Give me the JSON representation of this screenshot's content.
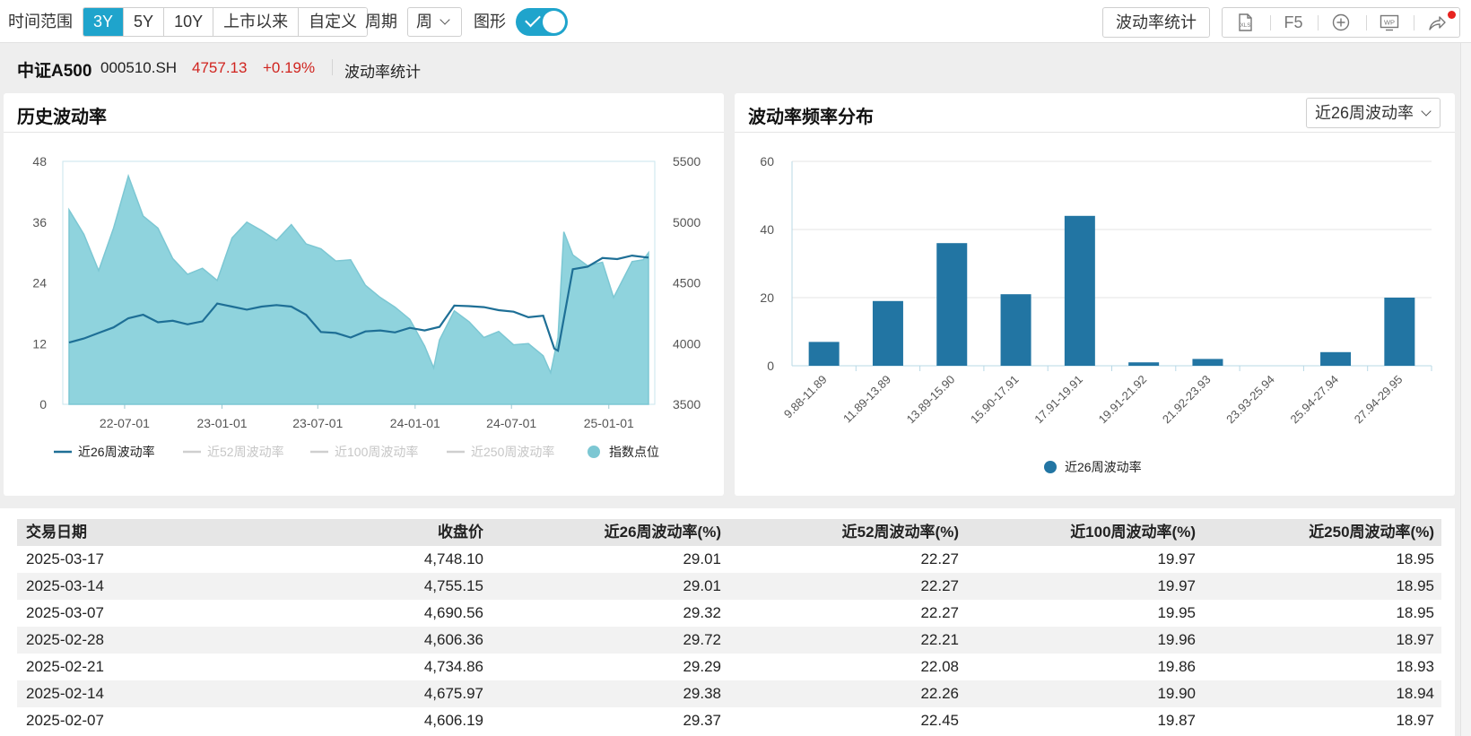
{
  "toolbar": {
    "range_label": "时间范围",
    "range_options": [
      "3Y",
      "5Y",
      "10Y",
      "上市以来",
      "自定义"
    ],
    "range_active": "3Y",
    "period_label": "周期",
    "period_value": "周",
    "chart_label": "图形",
    "stats_button": "波动率统计",
    "icons": [
      "xls-export-icon",
      "refresh-icon",
      "add-icon",
      "wp-export-icon",
      "share-icon"
    ],
    "refresh_label": "F5",
    "xls_label": "XLS",
    "wp_label": "WP"
  },
  "info": {
    "name": "中证A500",
    "code": "000510.SH",
    "price": "4757.13",
    "change": "+0.19%",
    "section": "波动率统计"
  },
  "colors": {
    "accent": "#1fa4cc",
    "up": "#d0241f",
    "line_series": "#1e6f96",
    "area_fill": "#8fd3dd",
    "bar_fill": "#2275a3"
  },
  "left_panel": {
    "title": "历史波动率"
  },
  "right_panel": {
    "title": "波动率频率分布",
    "select_value": "近26周波动率"
  },
  "chart_data": [
    {
      "type": "line",
      "title": "历史波动率",
      "x_ticks": [
        "22-07-01",
        "23-01-01",
        "23-07-01",
        "24-01-01",
        "24-07-01",
        "25-01-01"
      ],
      "x_range": [
        "2022-03-18",
        "2025-03-17"
      ],
      "ylim": [
        0,
        48
      ],
      "y_ticks": [
        "0",
        "12",
        "24",
        "36",
        "48"
      ],
      "y2lim": [
        3500,
        5500
      ],
      "y2_ticks": [
        "3500",
        "4000",
        "4500",
        "5000",
        "5500"
      ],
      "legend": [
        {
          "name": "近26周波动率",
          "active": true
        },
        {
          "name": "近52周波动率",
          "active": false
        },
        {
          "name": "近100周波动率",
          "active": false
        },
        {
          "name": "近250周波动率",
          "active": false
        },
        {
          "name": "指数点位",
          "active": true
        }
      ],
      "series": [
        {
          "name": "近26周波动率",
          "axis": "left",
          "x": [
            "2022-03-18",
            "2022-04-15",
            "2022-05-13",
            "2022-06-10",
            "2022-07-08",
            "2022-08-05",
            "2022-09-02",
            "2022-09-30",
            "2022-10-28",
            "2022-11-25",
            "2022-12-23",
            "2023-01-20",
            "2023-02-17",
            "2023-03-17",
            "2023-04-14",
            "2023-05-12",
            "2023-06-09",
            "2023-07-07",
            "2023-08-04",
            "2023-09-01",
            "2023-09-29",
            "2023-10-27",
            "2023-11-24",
            "2023-12-22",
            "2024-01-19",
            "2024-02-16",
            "2024-03-15",
            "2024-04-12",
            "2024-05-10",
            "2024-06-07",
            "2024-07-05",
            "2024-08-02",
            "2024-08-30",
            "2024-09-20",
            "2024-09-27",
            "2024-10-25",
            "2024-11-22",
            "2024-12-20",
            "2025-01-17",
            "2025-02-14",
            "2025-03-14",
            "2025-03-17"
          ],
          "values": [
            12.2,
            13.0,
            14.1,
            15.2,
            17.0,
            17.7,
            16.2,
            16.5,
            15.8,
            16.4,
            19.9,
            19.3,
            18.7,
            19.3,
            19.6,
            19.3,
            17.7,
            14.3,
            14.1,
            13.2,
            14.4,
            14.6,
            14.2,
            15.1,
            14.6,
            15.3,
            19.5,
            19.4,
            19.2,
            18.6,
            18.3,
            17.2,
            17.5,
            11.0,
            10.6,
            26.7,
            27.2,
            28.9,
            28.7,
            29.38,
            29.01,
            29.01
          ]
        },
        {
          "name": "指数点位",
          "axis": "right",
          "x": [
            "2022-03-18",
            "2022-04-15",
            "2022-05-13",
            "2022-06-10",
            "2022-07-08",
            "2022-08-05",
            "2022-09-02",
            "2022-09-30",
            "2022-10-28",
            "2022-11-25",
            "2022-12-23",
            "2023-01-20",
            "2023-02-17",
            "2023-03-17",
            "2023-04-14",
            "2023-05-12",
            "2023-06-09",
            "2023-07-07",
            "2023-08-04",
            "2023-09-01",
            "2023-09-29",
            "2023-10-27",
            "2023-11-24",
            "2023-12-22",
            "2024-01-19",
            "2024-02-05",
            "2024-02-16",
            "2024-03-15",
            "2024-04-12",
            "2024-05-10",
            "2024-06-07",
            "2024-07-05",
            "2024-08-02",
            "2024-08-30",
            "2024-09-13",
            "2024-09-27",
            "2024-10-08",
            "2024-10-25",
            "2024-11-22",
            "2024-12-20",
            "2025-01-10",
            "2025-02-14",
            "2025-03-07",
            "2025-03-17"
          ],
          "values": [
            5100,
            4900,
            4600,
            4950,
            5380,
            5050,
            4950,
            4700,
            4570,
            4620,
            4520,
            4870,
            5000,
            4930,
            4850,
            4980,
            4820,
            4780,
            4680,
            4690,
            4480,
            4380,
            4300,
            4200,
            3980,
            3800,
            4030,
            4270,
            4180,
            4050,
            4100,
            3990,
            4000,
            3900,
            3760,
            4050,
            4920,
            4730,
            4640,
            4670,
            4380,
            4675,
            4690,
            4748
          ]
        }
      ]
    },
    {
      "type": "bar",
      "title": "波动率频率分布",
      "categories": [
        "9.88-11.89",
        "11.89-13.89",
        "13.89-15.90",
        "15.90-17.91",
        "17.91-19.91",
        "19.91-21.92",
        "21.92-23.93",
        "23.93-25.94",
        "25.94-27.94",
        "27.94-29.95"
      ],
      "ylim": [
        0,
        60
      ],
      "y_ticks": [
        "0",
        "20",
        "40",
        "60"
      ],
      "legend": [
        "近26周波动率"
      ],
      "series": [
        {
          "name": "近26周波动率",
          "values": [
            7,
            19,
            36,
            21,
            44,
            1,
            2,
            0,
            4,
            20
          ]
        }
      ]
    }
  ],
  "table": {
    "headers": [
      "交易日期",
      "收盘价",
      "近26周波动率(%)",
      "近52周波动率(%)",
      "近100周波动率(%)",
      "近250周波动率(%)"
    ],
    "rows": [
      [
        "2025-03-17",
        "4,748.10",
        "29.01",
        "22.27",
        "19.97",
        "18.95"
      ],
      [
        "2025-03-14",
        "4,755.15",
        "29.01",
        "22.27",
        "19.97",
        "18.95"
      ],
      [
        "2025-03-07",
        "4,690.56",
        "29.32",
        "22.27",
        "19.95",
        "18.95"
      ],
      [
        "2025-02-28",
        "4,606.36",
        "29.72",
        "22.21",
        "19.96",
        "18.97"
      ],
      [
        "2025-02-21",
        "4,734.86",
        "29.29",
        "22.08",
        "19.86",
        "18.93"
      ],
      [
        "2025-02-14",
        "4,675.97",
        "29.38",
        "22.26",
        "19.90",
        "18.94"
      ],
      [
        "2025-02-07",
        "4,606.19",
        "29.37",
        "22.45",
        "19.87",
        "18.97"
      ]
    ]
  }
}
